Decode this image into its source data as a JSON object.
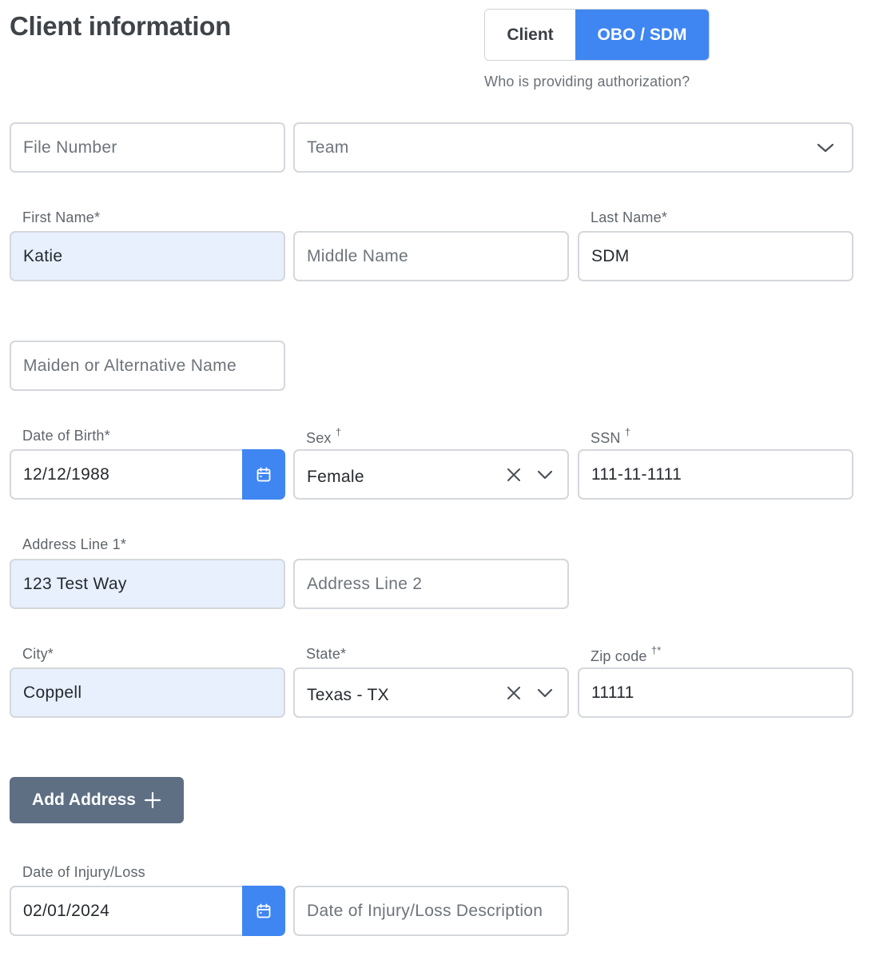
{
  "header": {
    "title": "Client information"
  },
  "auth_toggle": {
    "options": [
      "Client",
      "OBO / SDM"
    ],
    "selected": "OBO / SDM",
    "hint": "Who is providing authorization?"
  },
  "fields": {
    "file_number": {
      "placeholder": "File Number"
    },
    "team": {
      "placeholder": "Team"
    },
    "first_name": {
      "label": "First Name*",
      "value": "Katie"
    },
    "middle_name": {
      "placeholder": "Middle Name"
    },
    "last_name": {
      "label": "Last Name*",
      "value": "SDM"
    },
    "maiden_name": {
      "placeholder": "Maiden or Alternative Name"
    },
    "dob": {
      "label": "Date of Birth*",
      "value": "12/12/1988"
    },
    "sex": {
      "label": "Sex",
      "mark": "†",
      "value": "Female"
    },
    "ssn": {
      "label": "SSN",
      "mark": "†",
      "value": "111-11-1111"
    },
    "address1": {
      "label": "Address Line 1*",
      "value": "123 Test Way"
    },
    "address2": {
      "placeholder": "Address Line 2"
    },
    "city": {
      "label": "City*",
      "value": "Coppell"
    },
    "state": {
      "label": "State*",
      "value": "Texas - TX"
    },
    "zip": {
      "label": "Zip code",
      "mark": "†*",
      "value": "11111"
    },
    "injury_date": {
      "label": "Date of Injury/Loss",
      "value": "02/01/2024"
    },
    "injury_desc": {
      "placeholder": "Date of Injury/Loss Description"
    }
  },
  "buttons": {
    "add_address": "Add Address"
  },
  "colors": {
    "accent": "#3f86f2",
    "autofill_bg": "#e8f0fe",
    "button_gray": "#5e6f84",
    "border": "#d4d7dc"
  },
  "icons": {
    "calendar": "calendar-icon",
    "chevron": "chevron-down-icon",
    "clear": "close-icon",
    "plus": "plus-icon"
  }
}
